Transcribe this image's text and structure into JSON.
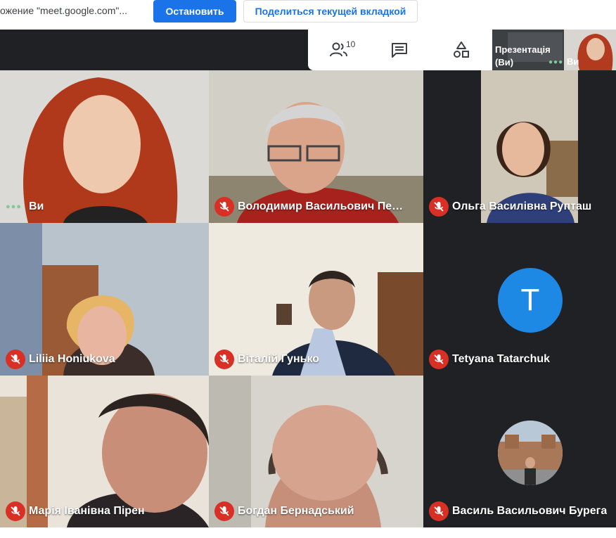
{
  "share_bar": {
    "text": "ожение \"meet.google.com\"...",
    "stop_label": "Остановить",
    "share_tab_label": "Поделиться текущей вкладкой"
  },
  "toolbar": {
    "people_count": "10",
    "icons": [
      "people-icon",
      "chat-icon",
      "activities-icon"
    ],
    "presentation_label": "Презентація (Ви)",
    "self_label": "Ви"
  },
  "colors": {
    "accent": "#1a73e8",
    "mute": "#d93025",
    "meet_bg": "#202124",
    "avatar": "#1e88e5",
    "speaking": "#81c995"
  },
  "participants": [
    {
      "name": "Ви",
      "muted": false
    },
    {
      "name": "Володимир Васильович Пер...",
      "muted": true
    },
    {
      "name": "Ольга Василівна Рупташ",
      "muted": true
    },
    {
      "name": "Liliia Honiukova",
      "muted": true
    },
    {
      "name": "Віталій Гунько",
      "muted": true
    },
    {
      "name": "Tetyana Tatarchuk",
      "muted": true,
      "avatar_letter": "T"
    },
    {
      "name": "Марія Іванівна Пірен",
      "muted": true
    },
    {
      "name": "Богдан Бернадський",
      "muted": true
    },
    {
      "name": "Василь Васильович Бурега",
      "muted": true
    }
  ]
}
